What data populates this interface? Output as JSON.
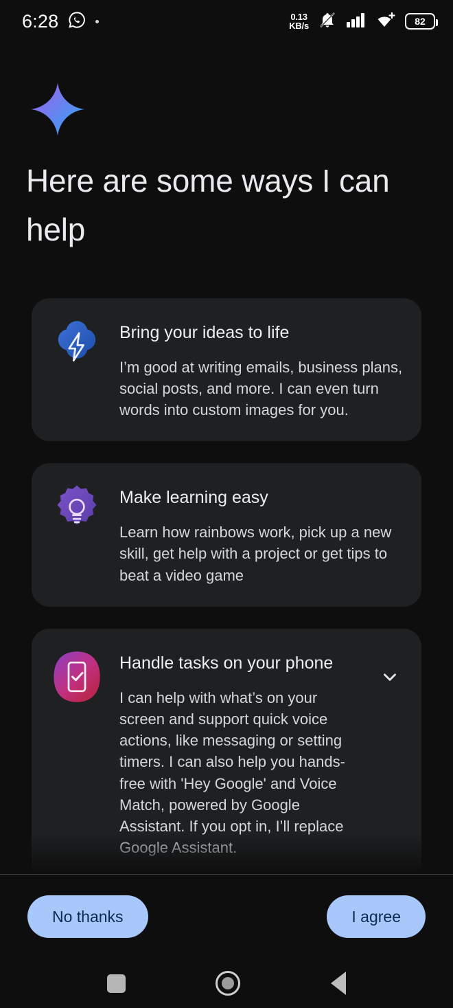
{
  "status_bar": {
    "time": "6:28",
    "whatsapp_icon": "whatsapp-icon",
    "network_speed_value": "0.13",
    "network_speed_unit": "KB/s",
    "silent_icon": "bell-muted-icon",
    "signal_icon": "cellular-signal-icon",
    "wifi_icon": "wifi-plus-icon",
    "battery_level": "82"
  },
  "hero": {
    "logo_icon": "gemini-sparkle-icon",
    "title": "Here are some ways I can help"
  },
  "cards": [
    {
      "icon": "lightning-bolt-blob-icon",
      "title": "Bring your ideas to life",
      "description": "I’m good at writing emails, business plans, social posts, and more. I can even turn words into custom images for you."
    },
    {
      "icon": "lightbulb-flower-icon",
      "title": "Make learning easy",
      "description": "Learn how rainbows work, pick up a new skill, get help with a project or get tips to beat a video game"
    },
    {
      "icon": "phone-checkmark-icon",
      "title": "Handle tasks on your phone",
      "description": "I can help with what’s on your screen and support quick voice actions, like messaging or setting timers. I can also help you hands-free with 'Hey Google' and Voice Match, powered by Google Assistant. If you opt in, I’ll replace Google Assistant.",
      "expander_icon": "chevron-down-icon",
      "expandable": true
    }
  ],
  "actions": {
    "decline_label": "No thanks",
    "accept_label": "I agree"
  },
  "nav_bar": {
    "recents_icon": "recents-square-icon",
    "home_icon": "home-circle-icon",
    "back_icon": "back-triangle-icon"
  },
  "colors": {
    "page_background": "#0e0e0e",
    "card_background": "#1e2022",
    "accent_button": "#a8c7fa",
    "button_text": "#0b2d52",
    "title_text": "#e8eaed",
    "body_text": "#d5d8da"
  }
}
